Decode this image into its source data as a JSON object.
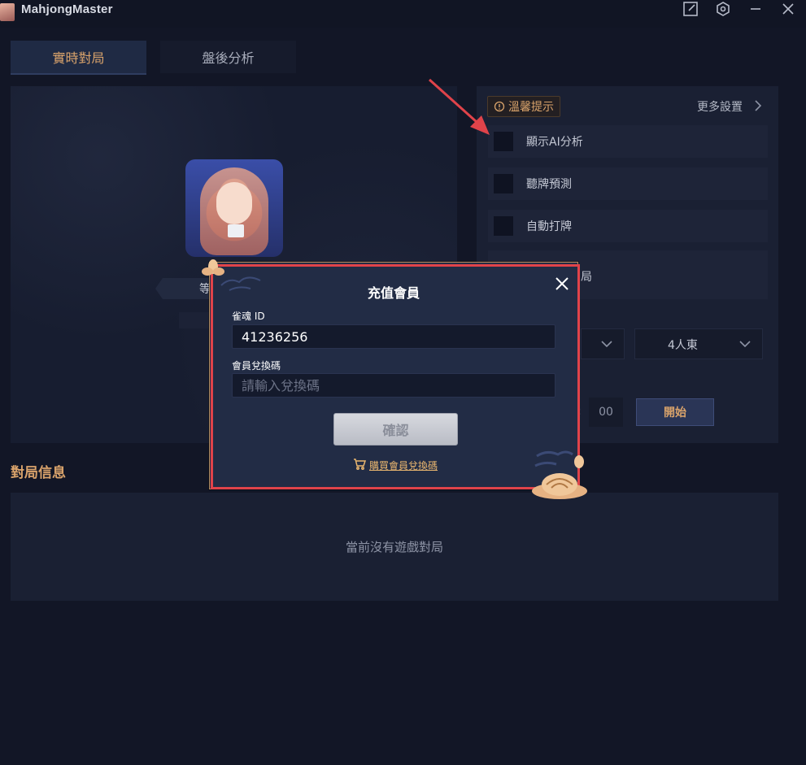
{
  "app": {
    "title": "MahjongMaster"
  },
  "window_controls": [
    "edit-icon",
    "settings-hex-icon",
    "minimize-icon",
    "close-icon"
  ],
  "tabs": [
    {
      "label": "實時對局",
      "active": true
    },
    {
      "label": "盤後分析",
      "active": false
    }
  ],
  "profile": {
    "level_text": "等"
  },
  "right_panel": {
    "tips_label": "溫馨提示",
    "more_settings": "更多設置",
    "options": [
      {
        "label": "顯示AI分析"
      },
      {
        "label": "聽牌預測"
      },
      {
        "label": "自動打牌"
      },
      {
        "label": "局"
      }
    ],
    "mode_select": "4人東",
    "time_value": "00",
    "start_label": "開始"
  },
  "game_info": {
    "title": "對局信息",
    "empty_text": "當前沒有遊戲對局"
  },
  "modal": {
    "title": "充值會員",
    "id_label": "雀魂 ID",
    "id_value": "41236256",
    "code_label": "會員兌換碼",
    "code_placeholder": "請輸入兌換碼",
    "confirm_label": "確認",
    "buy_link": "購買會員兌換碼"
  },
  "colors": {
    "accent_gold": "#d9a36b",
    "highlight_red": "#e0434a",
    "modal_bg": "#222c45",
    "page_bg": "#121626"
  }
}
